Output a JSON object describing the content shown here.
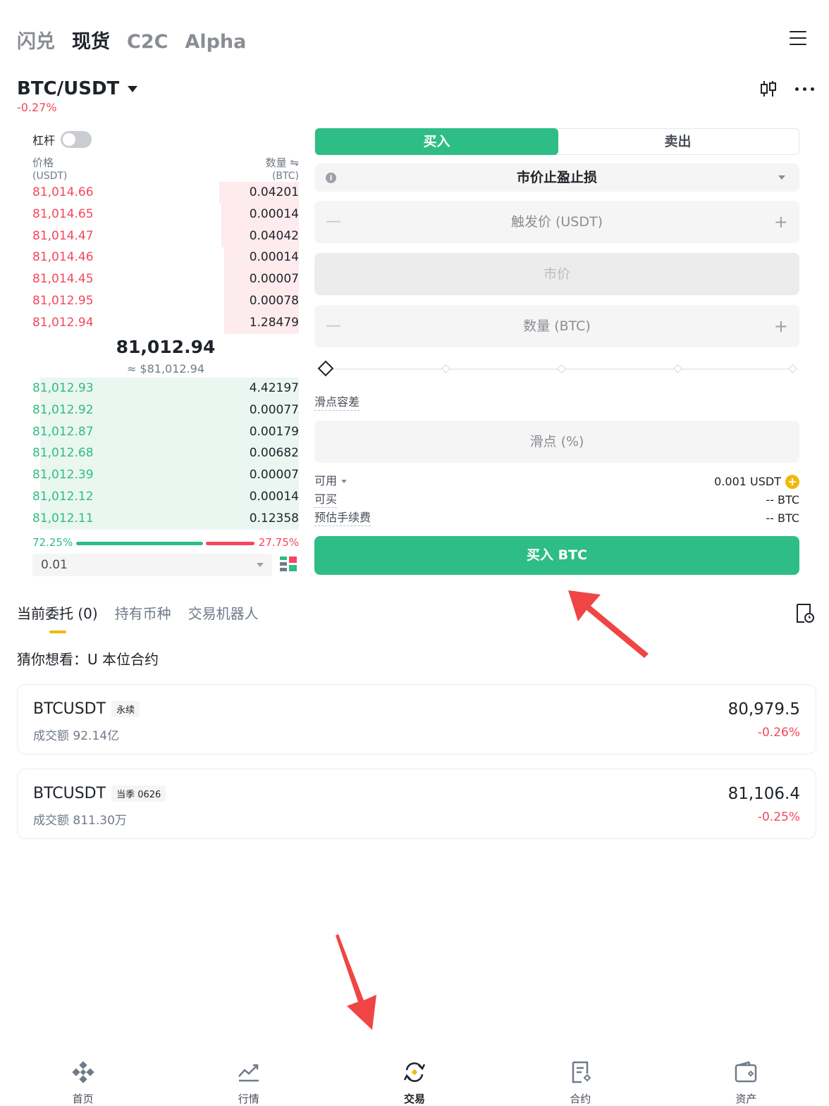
{
  "top_tabs": [
    "闪兑",
    "现货",
    "C2C",
    "Alpha"
  ],
  "pair": {
    "name": "BTC/USDT",
    "change": "-0.27%"
  },
  "orderbook": {
    "leverage_label": "杠杆",
    "price_header": "价格",
    "price_unit": "(USDT)",
    "qty_header": "数量 ⇋",
    "qty_unit": "(BTC)",
    "asks": [
      {
        "price": "81,014.66",
        "qty": "0.04201",
        "depth": 0.3
      },
      {
        "price": "81,014.65",
        "qty": "0.00014",
        "depth": 0.29
      },
      {
        "price": "81,014.47",
        "qty": "0.04042",
        "depth": 0.29
      },
      {
        "price": "81,014.46",
        "qty": "0.00014",
        "depth": 0.28
      },
      {
        "price": "81,014.45",
        "qty": "0.00007",
        "depth": 0.28
      },
      {
        "price": "81,012.95",
        "qty": "0.00078",
        "depth": 0.28
      },
      {
        "price": "81,012.94",
        "qty": "1.28479",
        "depth": 0.28
      }
    ],
    "mid_price": "81,012.94",
    "mid_usd": "≈ $81,012.94",
    "bids": [
      {
        "price": "81,012.93",
        "qty": "4.42197",
        "depth": 0.97
      },
      {
        "price": "81,012.92",
        "qty": "0.00077",
        "depth": 0.97
      },
      {
        "price": "81,012.87",
        "qty": "0.00179",
        "depth": 0.97
      },
      {
        "price": "81,012.68",
        "qty": "0.00682",
        "depth": 0.97
      },
      {
        "price": "81,012.39",
        "qty": "0.00007",
        "depth": 0.97
      },
      {
        "price": "81,012.12",
        "qty": "0.00014",
        "depth": 0.97
      },
      {
        "price": "81,012.11",
        "qty": "0.12358",
        "depth": 0.97
      }
    ],
    "buy_ratio": "72.25%",
    "sell_ratio": "27.75%",
    "precision": "0.01"
  },
  "form": {
    "buy_tab": "买入",
    "sell_tab": "卖出",
    "order_type": "市价止盈止损",
    "trigger_placeholder": "触发价 (USDT)",
    "market_price": "市价",
    "qty_placeholder": "数量 (BTC)",
    "slippage_label": "滑点容差",
    "slippage_placeholder": "滑点 (%)",
    "available_label": "可用",
    "available_value": "0.001 USDT",
    "can_buy_label": "可买",
    "can_buy_value": "-- BTC",
    "fee_label": "预估手续费",
    "fee_value": "-- BTC",
    "submit_label": "买入 BTC"
  },
  "orders": {
    "tabs": [
      "当前委托 (0)",
      "持有币种",
      "交易机器人"
    ],
    "guess_label": "猜你想看：U 本位合约"
  },
  "suggestions": [
    {
      "symbol": "BTCUSDT",
      "tag": "永续",
      "volume": "成交额 92.14亿",
      "price": "80,979.5",
      "change": "-0.26%"
    },
    {
      "symbol": "BTCUSDT",
      "tag": "当季 0626",
      "volume": "成交额 811.30万",
      "price": "81,106.4",
      "change": "-0.25%"
    }
  ],
  "nav": [
    "首页",
    "行情",
    "交易",
    "合约",
    "资产"
  ],
  "colors": {
    "green": "#2ebd85",
    "red": "#f6465d",
    "accent": "#f0b90b",
    "arrow": "#f04545"
  }
}
